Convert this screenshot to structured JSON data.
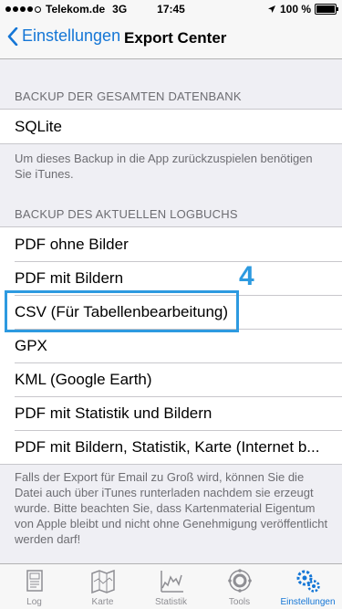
{
  "status": {
    "carrier": "Telekom.de",
    "network": "3G",
    "time": "17:45",
    "battery": "100 %",
    "battery_level": 1.0
  },
  "nav": {
    "back_label": "Einstellungen",
    "title": "Export Center"
  },
  "sections": {
    "db": {
      "header": "BACKUP DER GESAMTEN DATENBANK",
      "items": [
        "SQLite"
      ],
      "footer": "Um dieses Backup in die App  zurückzuspielen benötigen Sie iTunes."
    },
    "log": {
      "header": "BACKUP DES AKTUELLEN LOGBUCHS",
      "items": [
        "PDF ohne Bilder",
        "PDF mit Bildern",
        "CSV (Für Tabellenbearbeitung)",
        "GPX",
        "KML (Google Earth)",
        "PDF mit Statistik und Bildern",
        "PDF mit Bildern, Statistik, Karte (Internet b..."
      ],
      "footer": "Falls der Export für Email zu Groß wird, können Sie die Datei auch über iTunes runterladen nachdem sie erzeugt wurde. Bitte beachten Sie, dass Kartenmaterial Eigentum von Apple bleibt und nicht ohne Genehmigung veröffentlicht werden darf!"
    }
  },
  "annotation": {
    "marker": "4"
  },
  "tabs": [
    {
      "label": "Log",
      "icon": "logbook-icon",
      "active": false
    },
    {
      "label": "Karte",
      "icon": "map-icon",
      "active": false
    },
    {
      "label": "Statistik",
      "icon": "statistics-icon",
      "active": false
    },
    {
      "label": "Tools",
      "icon": "tools-icon",
      "active": false
    },
    {
      "label": "Einstellungen",
      "icon": "settings-icon",
      "active": true
    }
  ],
  "colors": {
    "accent": "#1476d6",
    "highlight": "#2d9ae0",
    "background": "#efeff4"
  }
}
